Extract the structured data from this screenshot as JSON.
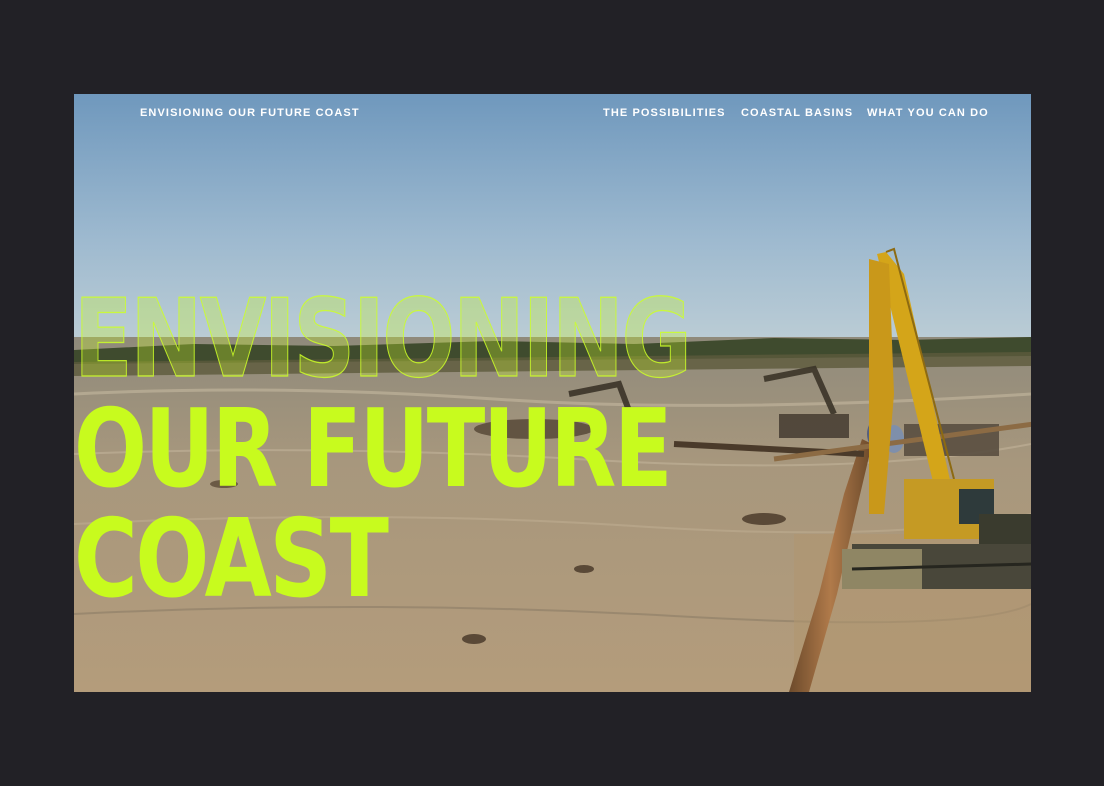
{
  "nav": {
    "brand": "ENVISIONING OUR FUTURE COAST",
    "links": [
      {
        "label": "THE POSSIBILITIES"
      },
      {
        "label": "COASTAL BASINS"
      },
      {
        "label": "WHAT YOU CAN DO"
      }
    ]
  },
  "hero": {
    "headline_line1": "ENVISIONING",
    "headline_line2": "OUR FUTURE",
    "headline_line3": "COAST",
    "accent_color": "#c8fb1e",
    "background_image": "coastal-restoration-excavators-video"
  },
  "colors": {
    "page_background": "#222126",
    "nav_text": "#ffffff",
    "sky": "#7fa2bf",
    "water": "#a89374"
  }
}
